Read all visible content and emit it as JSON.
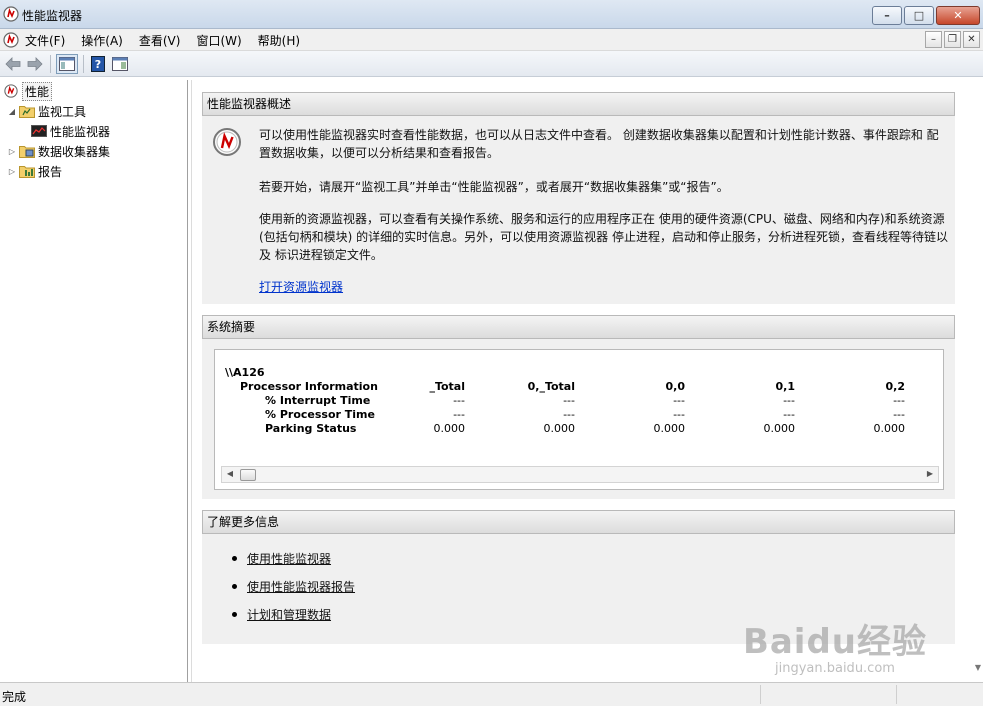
{
  "window": {
    "title": "性能监视器",
    "buttons": {
      "minimize": "–",
      "maximize": "□",
      "close": "✕"
    }
  },
  "menu": {
    "items": [
      "文件(F)",
      "操作(A)",
      "查看(V)",
      "窗口(W)",
      "帮助(H)"
    ]
  },
  "tree": {
    "root": "性能",
    "monitor_tools": "监视工具",
    "perf_monitor": "性能监视器",
    "data_collector_sets": "数据收集器集",
    "reports": "报告"
  },
  "overview": {
    "header": "性能监视器概述",
    "para1": "可以使用性能监视器实时查看性能数据，也可以从日志文件中查看。 创建数据收集器集以配置和计划性能计数器、事件跟踪和 配置数据收集，以便可以分析结果和查看报告。",
    "para2": "若要开始，请展开“监视工具”并单击“性能监视器”，或者展开“数据收集器集”或“报告”。",
    "para3": "使用新的资源监视器，可以查看有关操作系统、服务和运行的应用程序正在 使用的硬件资源(CPU、磁盘、网络和内存)和系统资源(包括句柄和模块) 的详细的实时信息。另外，可以使用资源监视器 停止进程，启动和停止服务，分析进程死锁，查看线程等待链以及 标识进程锁定文件。",
    "link": "打开资源监视器"
  },
  "summary": {
    "header": "系统摘要",
    "machine": "\\\\A126",
    "object": "Processor Information",
    "columns": [
      "_Total",
      "0,_Total",
      "0,0",
      "0,1",
      "0,2"
    ],
    "counters": [
      {
        "name": "% Interrupt Time",
        "values": [
          "---",
          "---",
          "---",
          "---",
          "---"
        ]
      },
      {
        "name": "% Processor Time",
        "values": [
          "---",
          "---",
          "---",
          "---",
          "---"
        ]
      },
      {
        "name": "Parking Status",
        "values": [
          "0.000",
          "0.000",
          "0.000",
          "0.000",
          "0.000"
        ]
      }
    ]
  },
  "more_info": {
    "header": "了解更多信息",
    "links": [
      "使用性能监视器",
      "使用性能监视器报告",
      "计划和管理数据"
    ]
  },
  "status": {
    "text": "完成"
  },
  "watermark": {
    "main": "Baidu经验",
    "sub": "jingyan.baidu.com"
  }
}
